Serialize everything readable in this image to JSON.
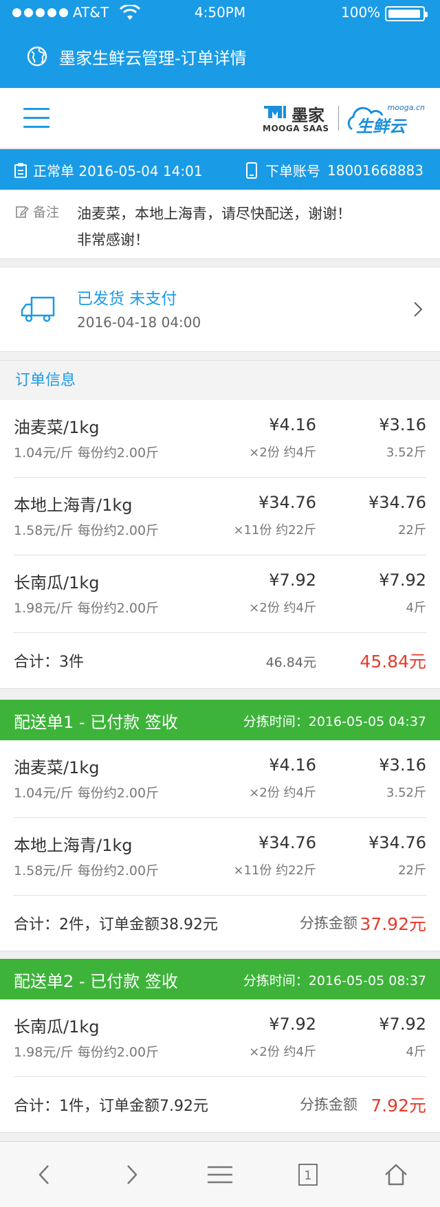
{
  "status": {
    "carrier": "AT&T",
    "time": "4:50PM",
    "battery": "100%"
  },
  "app": {
    "title": "墨家生鲜云管理-订单详情"
  },
  "logo": {
    "brand_cn": "墨家",
    "brand_en": "MOOGA SAAS",
    "cloud_domain": "mooga.cn",
    "cloud_name": "生鲜云"
  },
  "order": {
    "type_date": "正常单 2016-05-04 14:01",
    "account_label": "下单账号",
    "account": "18001668883"
  },
  "remark": {
    "label": "备注",
    "line1": "油麦菜，本地上海青，请尽快配送，谢谢！",
    "line2": "非常感谢！"
  },
  "shipping": {
    "status": "已发货 未支付",
    "time": "2016-04-18 04:00"
  },
  "order_info": {
    "title": "订单信息",
    "items": [
      {
        "name": "油麦菜/1kg",
        "unit": "1.04元/斤  每份约2.00斤",
        "price": "¥4.16",
        "qty": "×2份 约4斤",
        "amount": "¥3.16",
        "weight": "3.52斤"
      },
      {
        "name": "本地上海青/1kg",
        "unit": "1.58元/斤  每份约2.00斤",
        "price": "¥34.76",
        "qty": "×11份 约22斤",
        "amount": "¥34.76",
        "weight": "22斤"
      },
      {
        "name": "长南瓜/1kg",
        "unit": "1.98元/斤  每份约2.00斤",
        "price": "¥7.92",
        "qty": "×2份 约4斤",
        "amount": "¥7.92",
        "weight": "4斤"
      }
    ],
    "total_label": "合计：3件",
    "total_sub": "46.84元",
    "total_amount": "45.84元"
  },
  "delivery1": {
    "title": "配送单1 - 已付款 签收",
    "sort_time": "分拣时间：2016-05-05 04:37",
    "items": [
      {
        "name": "油麦菜/1kg",
        "unit": "1.04元/斤  每份约2.00斤",
        "price": "¥4.16",
        "qty": "×2份 约4斤",
        "amount": "¥3.16",
        "weight": "3.52斤"
      },
      {
        "name": "本地上海青/1kg",
        "unit": "1.58元/斤  每份约2.00斤",
        "price": "¥34.76",
        "qty": "×11份 约22斤",
        "amount": "¥34.76",
        "weight": "22斤"
      }
    ],
    "total_label": "合计：2件，订单金额38.92元",
    "sort_label": "分拣金额",
    "sort_amount": "37.92元"
  },
  "delivery2": {
    "title": "配送单2 - 已付款 签收",
    "sort_time": "分拣时间：2016-05-05 08:37",
    "items": [
      {
        "name": "长南瓜/1kg",
        "unit": "1.98元/斤  每份约2.00斤",
        "price": "¥7.92",
        "qty": "×2份 约4斤",
        "amount": "¥7.92",
        "weight": "4斤"
      }
    ],
    "total_label": "合计：1件，订单金额7.92元",
    "sort_label": "分拣金额",
    "sort_amount": "7.92元"
  },
  "nav": {
    "tab_count": "1"
  }
}
